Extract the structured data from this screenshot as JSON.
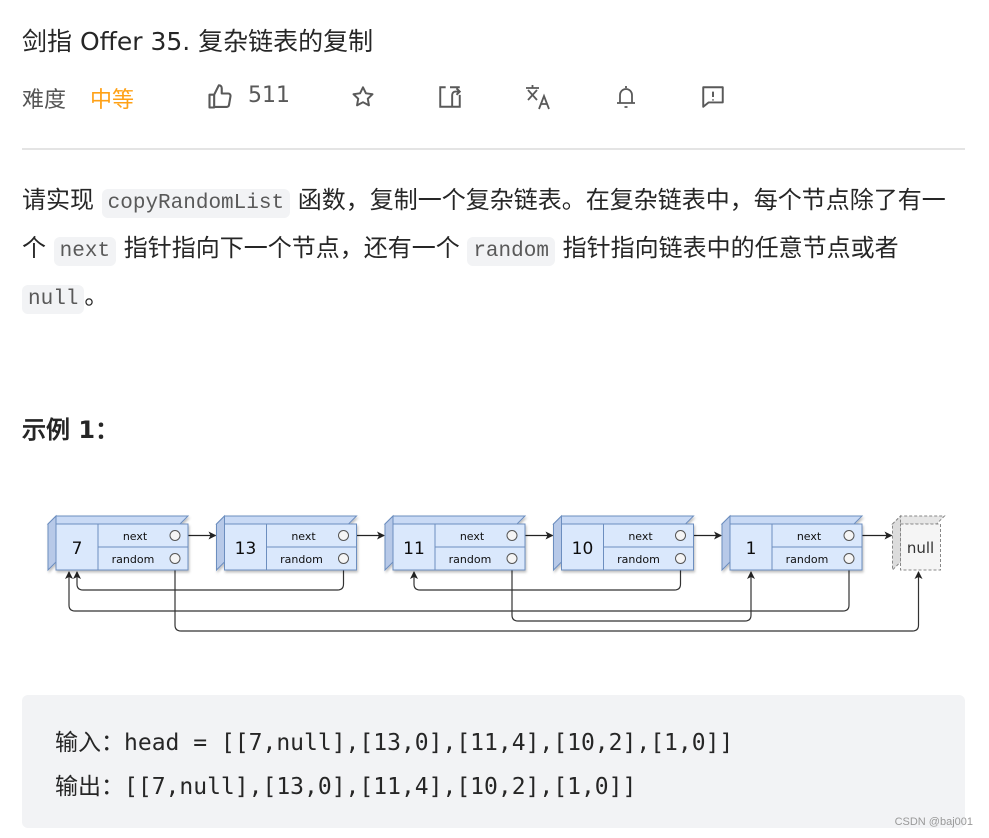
{
  "header": {
    "title": "剑指 Offer 35. 复杂链表的复制",
    "difficulty_label": "难度",
    "difficulty_value": "中等",
    "likes": "511",
    "colors": {
      "difficulty": "#ffa116",
      "text": "#262626",
      "icon": "#595959"
    },
    "icons": [
      "thumbs-up-icon",
      "star-icon",
      "share-icon",
      "translate-icon",
      "bell-icon",
      "feedback-icon"
    ]
  },
  "description": {
    "p1_a": "请实现 ",
    "code1": "copyRandomList",
    "p1_b": " 函数，复制一个复杂链表。在复杂链表中，每个节点除了有一个 ",
    "code2": "next",
    "p1_c": " 指针指向下一个节点，还有一个 ",
    "code3": "random",
    "p1_d": " 指针指向链表中的任意节点或者 ",
    "code4": "null",
    "p1_e": "。"
  },
  "example": {
    "heading": "示例 1：",
    "diagram": {
      "nodes": [
        {
          "value": "7",
          "next_label": "next",
          "random_label": "random"
        },
        {
          "value": "13",
          "next_label": "next",
          "random_label": "random"
        },
        {
          "value": "11",
          "next_label": "next",
          "random_label": "random"
        },
        {
          "value": "10",
          "next_label": "next",
          "random_label": "random"
        },
        {
          "value": "1",
          "next_label": "next",
          "random_label": "random"
        }
      ],
      "null_label": "null",
      "random_links": [
        {
          "from": 0,
          "to": "null"
        },
        {
          "from": 1,
          "to": 0
        },
        {
          "from": 2,
          "to": 4
        },
        {
          "from": 3,
          "to": 2
        },
        {
          "from": 4,
          "to": 0
        }
      ]
    },
    "input_line": "输入：head = [[7,null],[13,0],[11,4],[10,2],[1,0]]",
    "output_line": "输出：[[7,null],[13,0],[11,4],[10,2],[1,0]]"
  },
  "watermark": "CSDN @baj001"
}
